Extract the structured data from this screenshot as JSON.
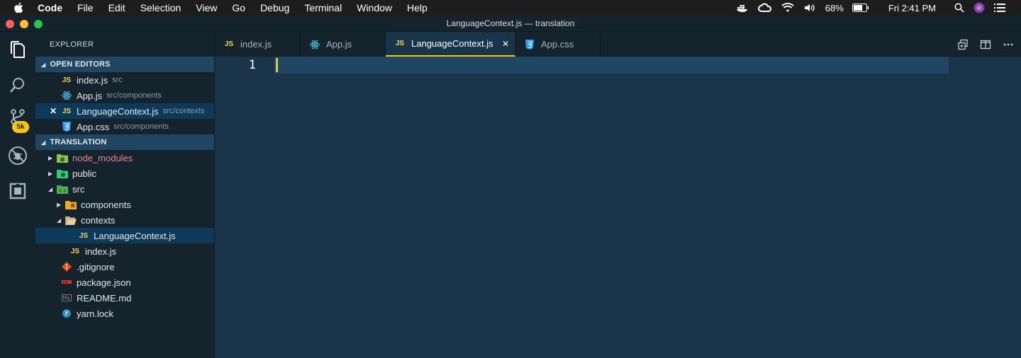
{
  "menubar": {
    "app_name": "Code",
    "items": [
      "File",
      "Edit",
      "Selection",
      "View",
      "Go",
      "Debug",
      "Terminal",
      "Window",
      "Help"
    ],
    "battery": "68%",
    "clock": "Fri 2:41 PM"
  },
  "window": {
    "title": "LanguageContext.js — translation"
  },
  "activity": {
    "badge": "5k"
  },
  "sidebar": {
    "title": "EXPLORER",
    "open_editors_label": "OPEN EDITORS",
    "open_editors": [
      {
        "icon": "JS",
        "name": "index.js",
        "path": "src"
      },
      {
        "icon": "react",
        "name": "App.js",
        "path": "src/components"
      },
      {
        "icon": "JS",
        "name": "LanguageContext.js",
        "path": "src/contexts"
      },
      {
        "icon": "css",
        "name": "App.css",
        "path": "src/components"
      }
    ],
    "project_label": "TRANSLATION",
    "tree": [
      {
        "name": "node_modules"
      },
      {
        "name": "public"
      },
      {
        "name": "src"
      },
      {
        "name": "components"
      },
      {
        "name": "contexts"
      },
      {
        "name": "LanguageContext.js"
      },
      {
        "name": "index.js"
      },
      {
        "name": ".gitignore"
      },
      {
        "name": "package.json"
      },
      {
        "name": "README.md"
      },
      {
        "name": "yarn.lock"
      }
    ]
  },
  "tabs": [
    {
      "label": "index.js"
    },
    {
      "label": "App.js"
    },
    {
      "label": "LanguageContext.js"
    },
    {
      "label": "App.css"
    }
  ],
  "editor": {
    "line_number": "1"
  },
  "colors": {
    "accent": "#ffc600",
    "background": "#193549",
    "sidebar": "#15232d",
    "selection": "#0d3a58"
  }
}
